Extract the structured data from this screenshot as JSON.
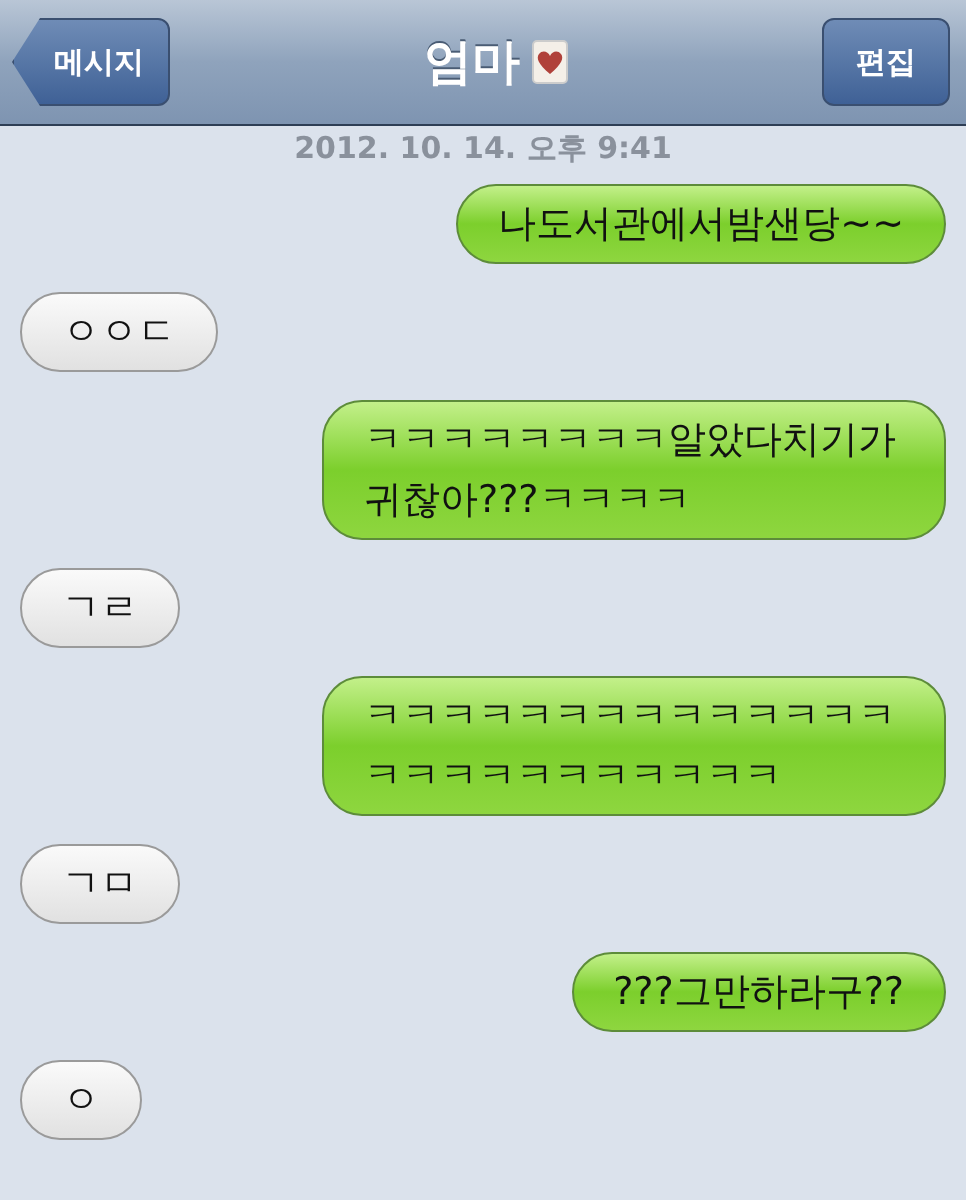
{
  "nav": {
    "back": "메시지",
    "title": "엄마",
    "edit": "편집"
  },
  "timestamp": "2012. 10. 14. 오후 9:41",
  "messages": [
    {
      "kind": "sent",
      "text": "나도서관에서밤샌당~~"
    },
    {
      "kind": "received",
      "text": "ㅇㅇㄷ"
    },
    {
      "kind": "sent",
      "text": "ㅋㅋㅋㅋㅋㅋㅋㅋ알았다치기가귀찮아???ㅋㅋㅋㅋ"
    },
    {
      "kind": "received",
      "text": "ㄱㄹ"
    },
    {
      "kind": "sent",
      "text": "ㅋㅋㅋㅋㅋㅋㅋㅋㅋㅋㅋㅋㅋㅋㅋㅋㅋㅋㅋㅋㅋㅋㅋㅋㅋ"
    },
    {
      "kind": "received",
      "text": "ㄱㅁ"
    },
    {
      "kind": "sent",
      "text": "???그만하라구??"
    },
    {
      "kind": "received",
      "text": "ㅇ"
    }
  ]
}
